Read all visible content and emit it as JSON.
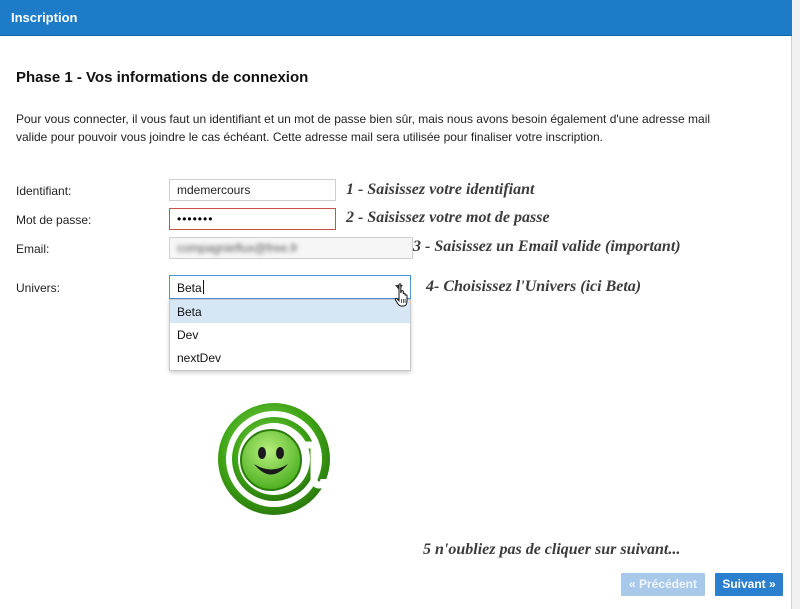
{
  "window": {
    "title": "Inscription"
  },
  "phase": {
    "title": "Phase 1 - Vos informations de connexion",
    "intro_line1": "Pour vous connecter, il vous faut un identifiant et un mot de passe bien sûr, mais nous avons besoin également d'une adresse mail",
    "intro_line2": "valide pour pouvoir vous joindre le cas échéant. Cette adresse mail sera utilisée pour finaliser votre inscription."
  },
  "form": {
    "identifiant": {
      "label": "Identifiant:",
      "value": "mdemercours"
    },
    "password": {
      "label": "Mot de passe:",
      "value": "•••••••"
    },
    "email": {
      "label": "Email:",
      "value": "compagnieflux@free.fr"
    },
    "univers": {
      "label": "Univers:",
      "value": "Beta",
      "options": [
        "Beta",
        "Dev",
        "nextDev"
      ],
      "highlighted": "Beta"
    }
  },
  "annotations": {
    "step1": "1 - Saisissez votre identifiant",
    "step2": "2 - Saisissez votre mot de passe",
    "step3": "3 - Saisissez un Email valide (important)",
    "step4": "4- Choisissez l'Univers (ici Beta)",
    "step5": "5 n'oubliez pas de cliquer sur suivant..."
  },
  "buttons": {
    "prev": "« Précédent",
    "next": "Suivant »"
  },
  "colors": {
    "titlebar": "#1d7bc8",
    "button_next": "#2b7fcf",
    "button_prev_disabled": "#a9c9ea",
    "logo_green": "#4caf1f"
  },
  "icons": {
    "logo": "smiley-at-logo-icon",
    "cursor": "hand-pointer-icon",
    "dropdown": "chevron-down-icon"
  }
}
